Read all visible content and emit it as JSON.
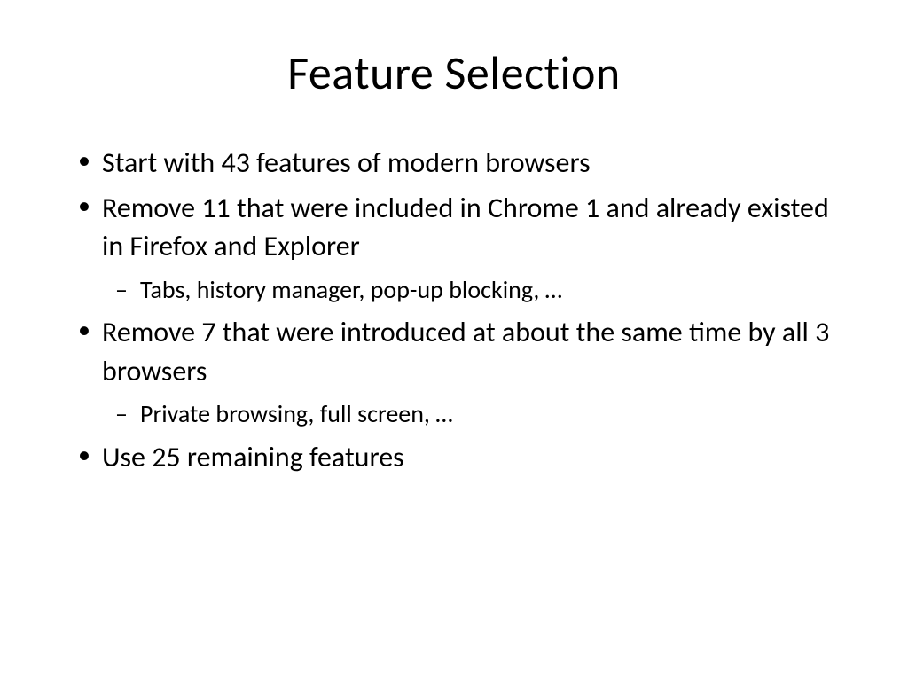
{
  "slide": {
    "title": "Feature Selection",
    "bullets": {
      "b1": "Start with 43 features of modern browsers",
      "b2": "Remove 11 that were included in Chrome 1 and already existed in Firefox and Explorer",
      "b2_sub": "Tabs, history manager, pop-up blocking, …",
      "b3": "Remove 7 that were introduced at about the same time by all 3 browsers",
      "b3_sub": "Private browsing, full screen, …",
      "b4": "Use 25 remaining features"
    }
  }
}
